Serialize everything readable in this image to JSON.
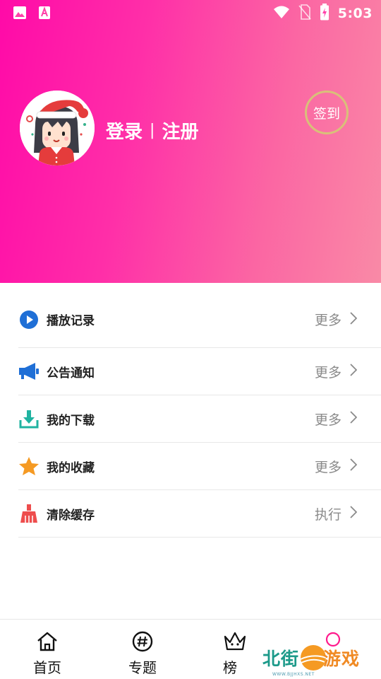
{
  "status_bar": {
    "time": "5:03",
    "left_icons": [
      "image-icon",
      "font-icon"
    ],
    "right_icons": [
      "wifi-icon",
      "no-sim-icon",
      "battery-charging-icon"
    ]
  },
  "profile": {
    "login_label": "登录",
    "separator": "|",
    "register_label": "注册",
    "signin_label": "签到"
  },
  "menu": {
    "items": [
      {
        "label": "播放记录",
        "action": "更多",
        "icon": "play-circle-icon",
        "color": "#1f6fd6"
      },
      {
        "label": "公告通知",
        "action": "更多",
        "icon": "megaphone-icon",
        "color": "#1f6fd6"
      },
      {
        "label": "我的下载",
        "action": "更多",
        "icon": "download-icon",
        "color": "#20b3a1"
      },
      {
        "label": "我的收藏",
        "action": "更多",
        "icon": "star-icon",
        "color": "#f59a23"
      },
      {
        "label": "清除缓存",
        "action": "执行",
        "icon": "broom-icon",
        "color": "#ee4d4d"
      }
    ]
  },
  "bottom_nav": {
    "tabs": [
      {
        "label": "首页",
        "icon": "home-icon"
      },
      {
        "label": "专题",
        "icon": "hashtag-icon"
      },
      {
        "label": "榜",
        "icon": "crown-icon"
      },
      {
        "label": "",
        "icon": "profile-icon"
      }
    ]
  },
  "watermark": {
    "text_a": "北街",
    "text_b": "游戏",
    "sub": "WWW.BJJHXS.NET"
  },
  "colors": {
    "header_gradient_start": "#ff0aa8",
    "header_gradient_end": "#f98aa6",
    "signin_ring": "#d9c079",
    "text_dark": "#222222",
    "text_muted": "#8a8a8a",
    "divider": "#e8e8e8"
  }
}
